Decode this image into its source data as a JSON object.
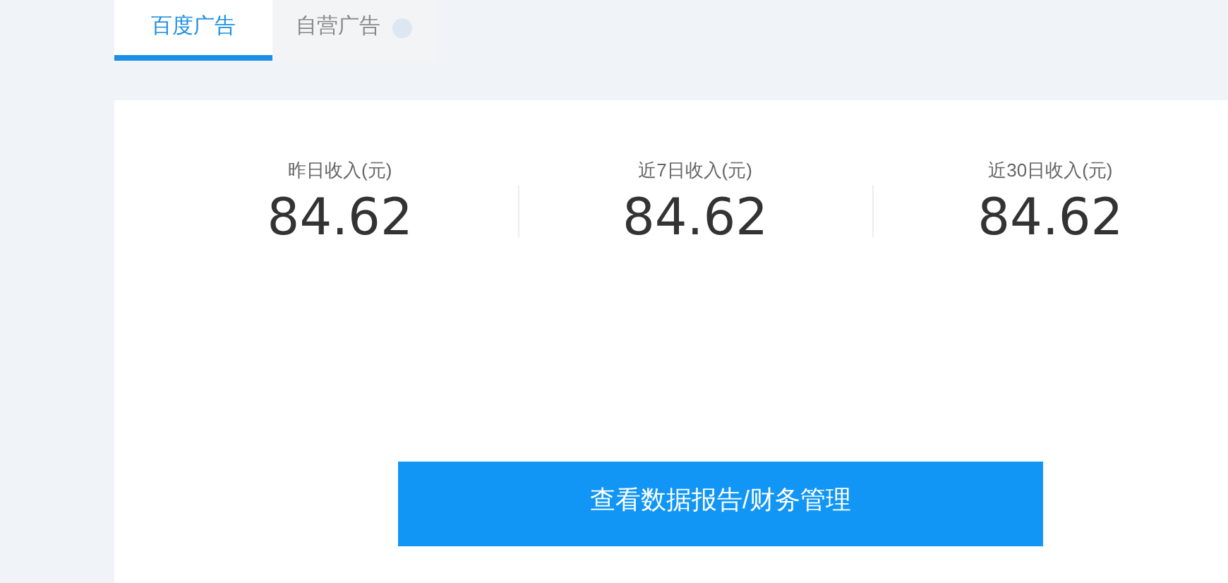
{
  "tabs": [
    {
      "label": "百度广告",
      "selected": true,
      "help": false
    },
    {
      "label": "自营广告",
      "selected": false,
      "help": true
    }
  ],
  "stats": [
    {
      "label": "昨日收入(元)",
      "value": "84.62"
    },
    {
      "label": "近7日收入(元)",
      "value": "84.62"
    },
    {
      "label": "近30日收入(元)",
      "value": "84.62"
    }
  ],
  "button": {
    "label": "查看数据报告/财务管理"
  }
}
